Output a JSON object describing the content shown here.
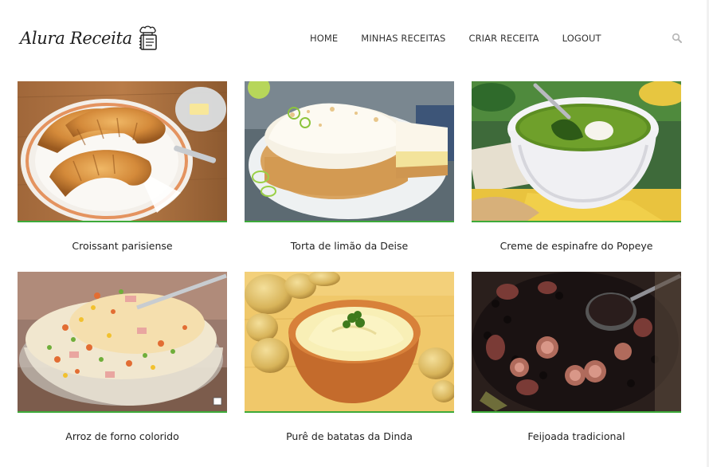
{
  "header": {
    "logo_text": "Alura Receita",
    "logo_icon": "chef-cookbook-icon",
    "nav": [
      {
        "label": "HOME"
      },
      {
        "label": "MINHAS RECEITAS"
      },
      {
        "label": "CRIAR RECEITA"
      },
      {
        "label": "LOGOUT"
      }
    ],
    "search_icon": "search-icon"
  },
  "recipes": [
    {
      "title": "Croissant parisiense",
      "image": "croissants-on-plate-photo"
    },
    {
      "title": "Torta de limão da Deise",
      "image": "lemon-meringue-pie-photo"
    },
    {
      "title": "Creme de espinafre do Popeye",
      "image": "spinach-cream-soup-photo"
    },
    {
      "title": "Arroz de forno colorido",
      "image": "baked-rice-casserole-photo"
    },
    {
      "title": "Purê de batatas da Dinda",
      "image": "mashed-potatoes-photo"
    },
    {
      "title": "Feijoada tradicional",
      "image": "feijoada-pot-photo"
    }
  ],
  "colors": {
    "accent_green": "#3daa3a",
    "text": "#222222",
    "nav_text": "#333333",
    "background": "#ffffff"
  }
}
